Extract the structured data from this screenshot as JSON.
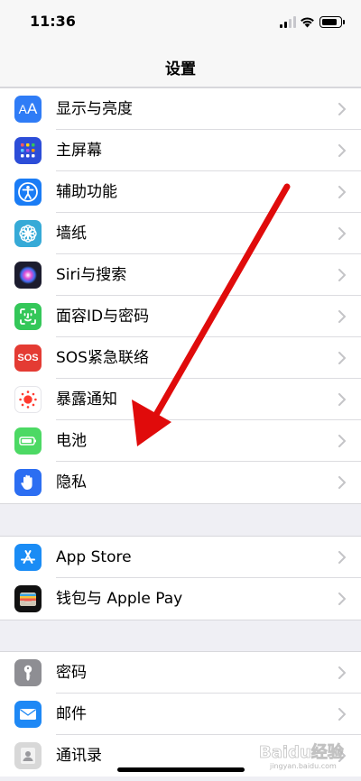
{
  "status_bar": {
    "time": "11:36",
    "battery_level": 0.85
  },
  "nav": {
    "title": "设置"
  },
  "groups": [
    {
      "items": [
        {
          "label": "显示与亮度",
          "icon": "display-brightness-icon",
          "color": "#2f7cf6"
        },
        {
          "label": "主屏幕",
          "icon": "home-screen-icon",
          "color": "#2c4dd8"
        },
        {
          "label": "辅助功能",
          "icon": "accessibility-icon",
          "color": "#1a7cf5"
        },
        {
          "label": "墙纸",
          "icon": "wallpaper-icon",
          "color": "#36aad7"
        },
        {
          "label": "Siri与搜索",
          "icon": "siri-icon",
          "color": "#1c1c2e"
        },
        {
          "label": "面容ID与密码",
          "icon": "face-id-icon",
          "color": "#34c759"
        },
        {
          "label": "SOS紧急联络",
          "icon": "sos-icon",
          "color": "#e43b33",
          "icon_text": "SOS"
        },
        {
          "label": "暴露通知",
          "icon": "exposure-notification-icon",
          "color": "#ffffff"
        },
        {
          "label": "电池",
          "icon": "battery-icon",
          "color": "#4cd964"
        },
        {
          "label": "隐私",
          "icon": "privacy-hand-icon",
          "color": "#2c6ef2"
        }
      ]
    },
    {
      "items": [
        {
          "label": "App Store",
          "icon": "app-store-icon",
          "color": "#1a8cf5"
        },
        {
          "label": "钱包与 Apple Pay",
          "icon": "wallet-icon",
          "color": "#111111"
        }
      ]
    },
    {
      "items": [
        {
          "label": "密码",
          "icon": "key-icon",
          "color": "#8e8e93"
        },
        {
          "label": "邮件",
          "icon": "mail-icon",
          "color": "#1e88f5"
        },
        {
          "label": "通讯录",
          "icon": "contacts-icon",
          "color": "#d8d8d8"
        }
      ]
    }
  ],
  "annotation": {
    "arrow_color": "#e00b0b"
  },
  "watermark": {
    "text": "Baidu经验",
    "subtext": "jingyan.baidu.com"
  }
}
